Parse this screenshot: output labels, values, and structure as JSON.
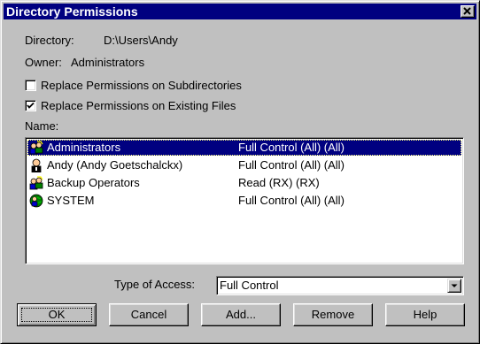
{
  "window": {
    "title": "Directory Permissions"
  },
  "directory": {
    "label": "Directory:",
    "value": "D:\\Users\\Andy"
  },
  "owner": {
    "label": "Owner:",
    "value": "Administrators"
  },
  "options": {
    "replace_subdirs": {
      "label": "Replace Permissions on Subdirectories",
      "checked": false
    },
    "replace_files": {
      "label": "Replace Permissions on Existing Files",
      "checked": true
    }
  },
  "name_label": "Name:",
  "entries": [
    {
      "name": "Administrators",
      "permission": "Full Control (All) (All)",
      "icon": "group-icon",
      "selected": true
    },
    {
      "name": "Andy (Andy Goetschalckx)",
      "permission": "Full Control (All) (All)",
      "icon": "user-icon",
      "selected": false
    },
    {
      "name": "Backup Operators",
      "permission": "Read (RX) (RX)",
      "icon": "group-icon",
      "selected": false
    },
    {
      "name": "SYSTEM",
      "permission": "Full Control (All) (All)",
      "icon": "system-group-icon",
      "selected": false
    }
  ],
  "access": {
    "label": "Type of Access:",
    "value": "Full Control"
  },
  "buttons": {
    "ok": "OK",
    "cancel": "Cancel",
    "add": "Add...",
    "remove": "Remove",
    "help": "Help"
  },
  "colors": {
    "selection": "#000080",
    "titlebar": "#000080",
    "face": "#c0c0c0"
  }
}
